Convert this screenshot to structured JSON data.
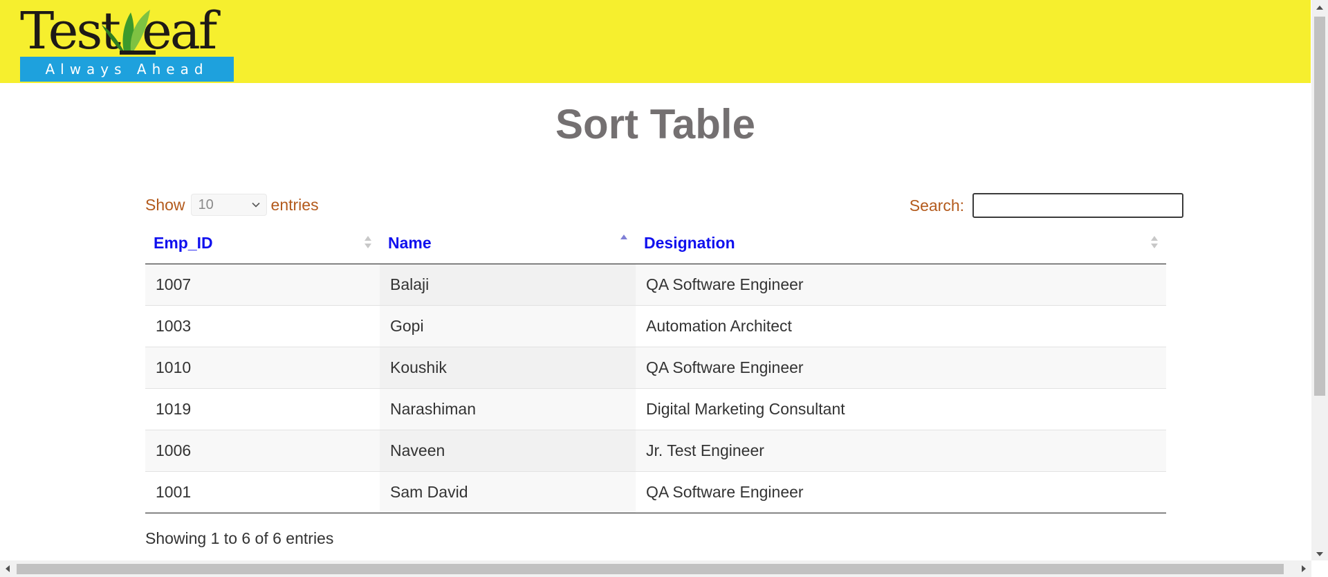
{
  "header": {
    "logo_text": "TestLeaf",
    "logo_tagline": "Always Ahead",
    "background_color": "#f6ef2e",
    "tagline_color": "#1ea1dd"
  },
  "title": "Sort Table",
  "controls": {
    "show_label": "Show",
    "page_length": "10",
    "entries_label": "entries",
    "search_label": "Search:",
    "search_value": ""
  },
  "table": {
    "columns": [
      "Emp_ID",
      "Name",
      "Designation"
    ],
    "sorted_column": "Name",
    "sort_direction": "ascending",
    "rows": [
      [
        "1007",
        "Balaji",
        "QA Software Engineer"
      ],
      [
        "1003",
        "Gopi",
        "Automation Architect"
      ],
      [
        "1010",
        "Koushik",
        "QA Software Engineer"
      ],
      [
        "1019",
        "Narashiman",
        "Digital Marketing Consultant"
      ],
      [
        "1006",
        "Naveen",
        "Jr. Test Engineer"
      ],
      [
        "1001",
        "Sam David",
        "QA Software Engineer"
      ]
    ]
  },
  "info": "Showing 1 to 6 of 6 entries"
}
